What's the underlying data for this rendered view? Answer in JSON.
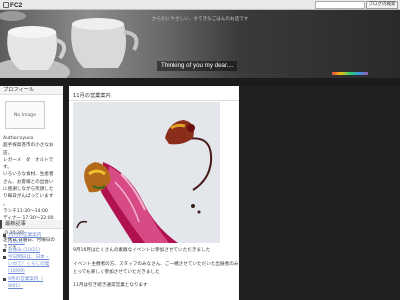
{
  "topbar": {
    "logo_text": "FC2",
    "search_button_label": "ブログ内検索"
  },
  "header": {
    "description": "からだにやさしい、すてきなごはんのお店です",
    "title": "Thinking of you my dear....",
    "fine_print": "・・・・・・・・・・・・・・・・・・"
  },
  "sidebar": {
    "profile_heading": "プロフィール",
    "no_image": "No Image",
    "author_lines": [
      "Author:syuco",
      "超手探高巻市の小さなお",
      "店。",
      "レガーメ　ダ　オルトで",
      "す。",
      "いろいろな食材、生産者",
      "さん、お客様との出会い",
      "に感謝しながら笑顔した",
      "り毎日がんばっています",
      "。",
      "ランチ11:30～14:00",
      "ディナー 17:30～22:00（L",
      ".O 20:30）",
      "定休日 日曜日、月曜日の",
      "ランチ"
    ],
    "recent_heading": "最新記事",
    "recent_items": [
      "11月の営業案内",
      "(11/01)",
      "お休み (10/21)",
      "今日明日は、日本・",
      "いわて！くらしの発",
      "(10/09)",
      "9月の営業案内（",
      "9/01）"
    ]
  },
  "main": {
    "entry_title": "11月の営業案内",
    "text_lines": [
      "9月16月はたくさんの素敵なイベントに参加させていただきました",
      "イベント主催者の方、スタッフのみなさん、ご一緒させていただいた出展者のみなさん、お立ち寄りくださったお客様、ありがとうございました",
      "とっても楽しく参加させていただきました",
      "11月は引き続き通常営業となります"
    ]
  },
  "colors": {
    "link": "#6a8ad6",
    "background": "#1c1c1c",
    "panel": "#ffffff"
  }
}
